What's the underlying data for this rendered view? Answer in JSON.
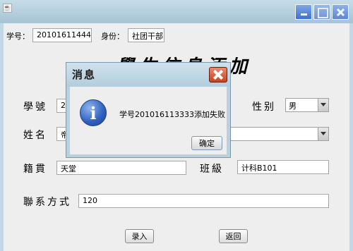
{
  "window": {
    "java_icon_glyph": "☕"
  },
  "top_bar": {
    "student_id_label": "学号：",
    "student_id_value": "201016114444",
    "identity_label": "身份：",
    "identity_value": "社团干部"
  },
  "form": {
    "title": "學生信息添加",
    "student_id_label": "學號",
    "student_id_value": "201016113333",
    "gender_label": "性别",
    "gender_value": "男",
    "name_label": "姓名",
    "name_value": "帝",
    "native_place_label": "籍貫",
    "native_place_value": "天堂",
    "class_label": "班級",
    "class_value": "计科B101",
    "contact_label": "聯系方式",
    "contact_value": "120",
    "submit_label": "录入",
    "back_label": "返回"
  },
  "dialog": {
    "title": "消息",
    "message": "学号201016113333添加失败",
    "ok_label": "确定",
    "icon_glyph": "i"
  }
}
